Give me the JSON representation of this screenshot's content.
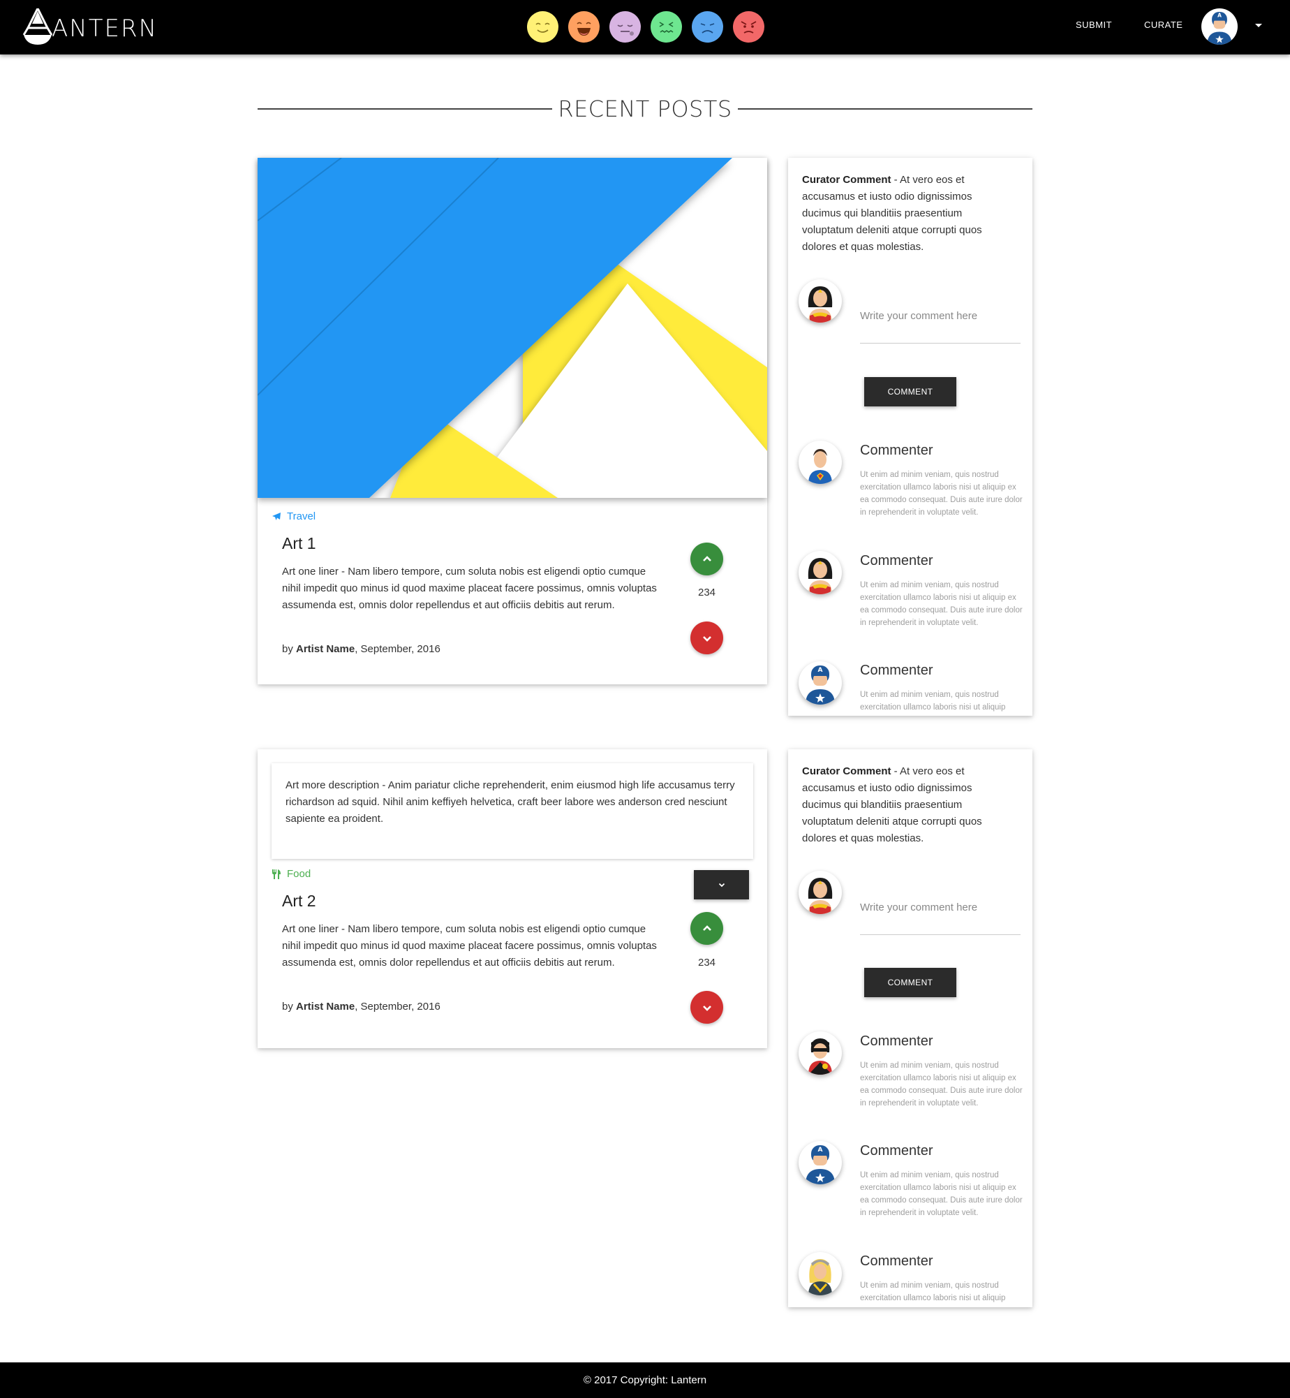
{
  "nav": {
    "brand": "ANTERN",
    "moods": [
      {
        "name": "happy",
        "color": "#fff176"
      },
      {
        "name": "excited",
        "color": "#ffa060"
      },
      {
        "name": "sleepy",
        "color": "#d8b4e2"
      },
      {
        "name": "sick",
        "color": "#6ee690"
      },
      {
        "name": "sad",
        "color": "#5aa6f0"
      },
      {
        "name": "angry",
        "color": "#f26868"
      }
    ],
    "submit": "SUBMIT",
    "curate": "CURATE"
  },
  "section_title": "RECENT POSTS",
  "posts": [
    {
      "category": "Travel",
      "category_color": "#2196f3",
      "title": "Art 1",
      "description": "Art one liner - Nam libero tempore, cum soluta nobis est eligendi optio cumque nihil impedit quo minus id quod maxime placeat facere possimus, omnis voluptas assumenda est, omnis dolor repellendus et aut officiis debitis aut rerum.",
      "by": "by ",
      "artist": "Artist Name",
      "date": ", September, 2016",
      "votes": "234"
    },
    {
      "more_description": "Art more description - Anim pariatur cliche reprehenderit, enim eiusmod high life accusamus terry richardson ad squid. Nihil anim keffiyeh helvetica, craft beer labore wes anderson cred nesciunt sapiente ea proident.",
      "category": "Food",
      "category_color": "#4caf50",
      "title": "Art 2",
      "description": "Art one liner - Nam libero tempore, cum soluta nobis est eligendi optio cumque nihil impedit quo minus id quod maxime placeat facere possimus, omnis voluptas assumenda est, omnis dolor repellendus et aut officiis debitis aut rerum.",
      "by": "by ",
      "artist": "Artist Name",
      "date": ", September, 2016",
      "votes": "234"
    }
  ],
  "sidebars": [
    {
      "curator_label": "Curator Comment",
      "curator_text": " - At vero eos et accusamus et iusto odio dignissimos ducimus qui blanditiis praesentium voluptatum deleniti atque corrupti quos dolores et quas molestias.",
      "placeholder": "Write your comment here",
      "button": "COMMENT",
      "comments": [
        {
          "name": "Commenter",
          "text": "Ut enim ad minim veniam, quis nostrud exercitation ullamco laboris nisi ut aliquip ex ea commodo consequat. Duis aute irure dolor in reprehenderit in voluptate velit."
        },
        {
          "name": "Commenter",
          "text": "Ut enim ad minim veniam, quis nostrud exercitation ullamco laboris nisi ut aliquip ex ea commodo consequat. Duis aute irure dolor in reprehenderit in voluptate velit."
        },
        {
          "name": "Commenter",
          "text": "Ut enim ad minim veniam, quis nostrud exercitation ullamco laboris nisi ut aliquip"
        }
      ]
    },
    {
      "curator_label": "Curator Comment",
      "curator_text": " - At vero eos et accusamus et iusto odio dignissimos ducimus qui blanditiis praesentium voluptatum deleniti atque corrupti quos dolores et quas molestias.",
      "placeholder": "Write your comment here",
      "button": "COMMENT",
      "comments": [
        {
          "name": "Commenter",
          "text": "Ut enim ad minim veniam, quis nostrud exercitation ullamco laboris nisi ut aliquip ex ea commodo consequat. Duis aute irure dolor in reprehenderit in voluptate velit."
        },
        {
          "name": "Commenter",
          "text": "Ut enim ad minim veniam, quis nostrud exercitation ullamco laboris nisi ut aliquip ex ea commodo consequat. Duis aute irure dolor in reprehenderit in voluptate velit."
        },
        {
          "name": "Commenter",
          "text": "Ut enim ad minim veniam, quis nostrud exercitation ullamco laboris nisi ut aliquip"
        }
      ]
    }
  ],
  "footer": "© 2017 Copyright: Lantern"
}
